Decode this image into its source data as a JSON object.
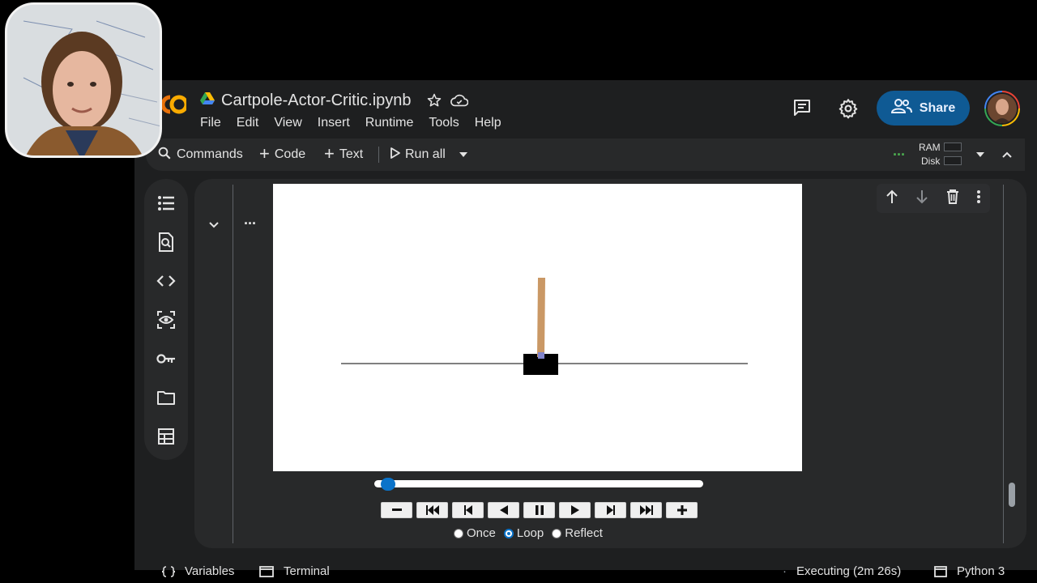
{
  "notebook": {
    "filename": "Cartpole-Actor-Critic.ipynb"
  },
  "menu": [
    "File",
    "Edit",
    "View",
    "Insert",
    "Runtime",
    "Tools",
    "Help"
  ],
  "header": {
    "share_label": "Share"
  },
  "toolbar": {
    "commands_label": "Commands",
    "code_label": "Code",
    "text_label": "Text",
    "run_all_label": "Run all",
    "ram_label": "RAM",
    "disk_label": "Disk"
  },
  "animation": {
    "frame_position": 0.02,
    "loop_mode": "Loop",
    "radio_labels": [
      "Once",
      "Loop",
      "Reflect"
    ],
    "buttons": [
      "minus",
      "first-frame",
      "prev-frame",
      "reverse",
      "pause",
      "play",
      "next-frame",
      "last-frame",
      "plus"
    ]
  },
  "statusbar": {
    "variables_label": "Variables",
    "terminal_label": "Terminal",
    "executing_label": "Executing (2m 26s)",
    "runtime_label": "Python 3"
  },
  "colors": {
    "accent": "#0b73c9",
    "share_bg": "#0f5a94",
    "pole": "#ca9865",
    "cart": "#000000",
    "axle": "#8184cb"
  }
}
